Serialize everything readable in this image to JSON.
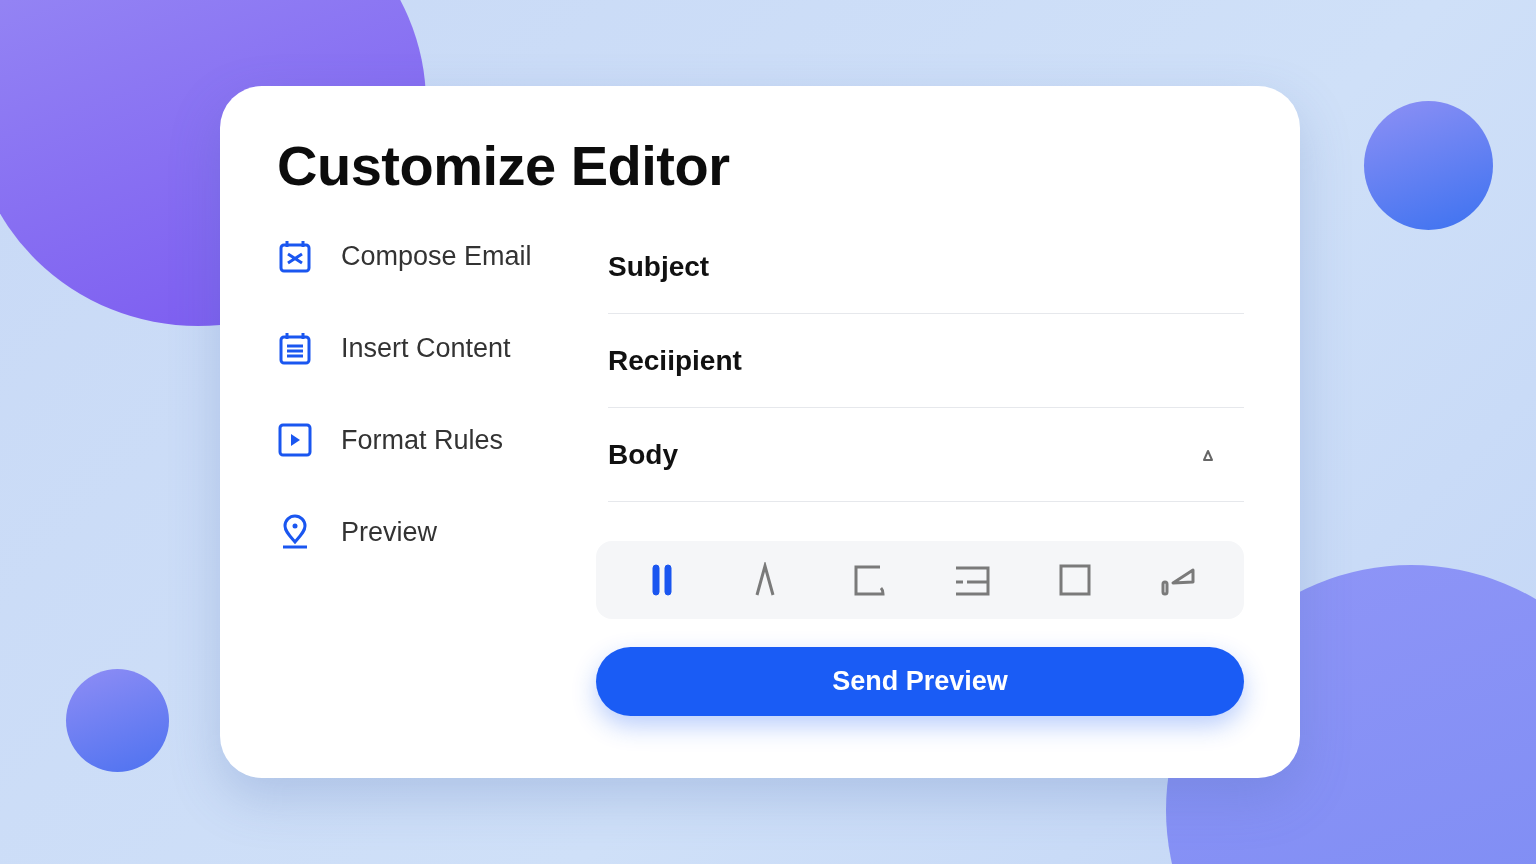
{
  "title": "Customize Editor",
  "nav": [
    {
      "label": "Compose Email",
      "kind": "calendar-x"
    },
    {
      "label": "Insert Content",
      "kind": "calendar-list"
    },
    {
      "label": "Format Rules",
      "kind": "play"
    },
    {
      "label": "Preview",
      "kind": "pin"
    }
  ],
  "fields": [
    {
      "label": "Subject",
      "kind": "text"
    },
    {
      "label": "Reciipient",
      "kind": "text"
    },
    {
      "label": "Body",
      "kind": "collapsible"
    }
  ],
  "toolbar": [
    {
      "kind": "pause",
      "selected": true
    },
    {
      "kind": "caret",
      "selected": false
    },
    {
      "kind": "corner",
      "selected": false
    },
    {
      "kind": "lines",
      "selected": false
    },
    {
      "kind": "square",
      "selected": false
    },
    {
      "kind": "wedge",
      "selected": false
    }
  ],
  "button": "Send Preview"
}
